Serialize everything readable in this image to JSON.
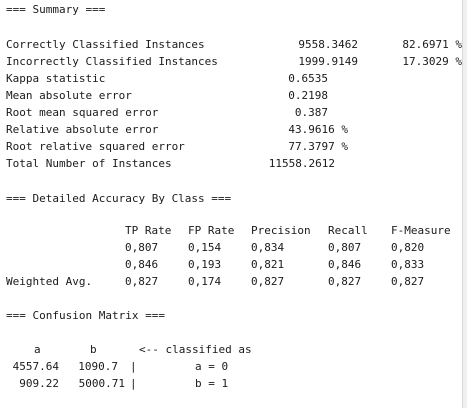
{
  "summary": {
    "header": "=== Summary ===",
    "rows": [
      {
        "label": "Correctly Classified Instances",
        "value": "9558.3462",
        "pct": "82.6971 %"
      },
      {
        "label": "Incorrectly Classified Instances",
        "value": "1999.9149",
        "pct": "17.3029 %"
      },
      {
        "label": "Kappa statistic",
        "value": "0.6535"
      },
      {
        "label": "Mean absolute error",
        "value": "0.2198"
      },
      {
        "label": "Root mean squared error",
        "value": "0.387"
      },
      {
        "label": "Relative absolute error",
        "value": "43.9616 %"
      },
      {
        "label": "Root relative squared error",
        "value": "77.3797 %"
      },
      {
        "label": "Total Number of Instances",
        "value": "11558.2612"
      }
    ]
  },
  "accuracy": {
    "header": "=== Detailed Accuracy By Class ===",
    "columns": [
      "TP Rate",
      "FP Rate",
      "Precision",
      "Recall",
      "F-Measure"
    ],
    "rows": [
      {
        "label": "",
        "cells": [
          "0,807",
          "0,154",
          "0,834",
          "0,807",
          "0,820"
        ]
      },
      {
        "label": "",
        "cells": [
          "0,846",
          "0,193",
          "0,821",
          "0,846",
          "0,833"
        ]
      },
      {
        "label": "Weighted Avg.",
        "cells": [
          "0,827",
          "0,174",
          "0,827",
          "0,827",
          "0,827"
        ]
      }
    ]
  },
  "confusion": {
    "header": "=== Confusion Matrix ===",
    "col_a": "a",
    "col_b": "b",
    "classified_as": "<-- classified as",
    "rows": [
      {
        "a": "4557.64",
        "b": "1090.7",
        "sep": "|",
        "cls": "a = 0"
      },
      {
        "a": "909.22",
        "b": "5000.71",
        "sep": "|",
        "cls": "b = 1"
      }
    ]
  }
}
